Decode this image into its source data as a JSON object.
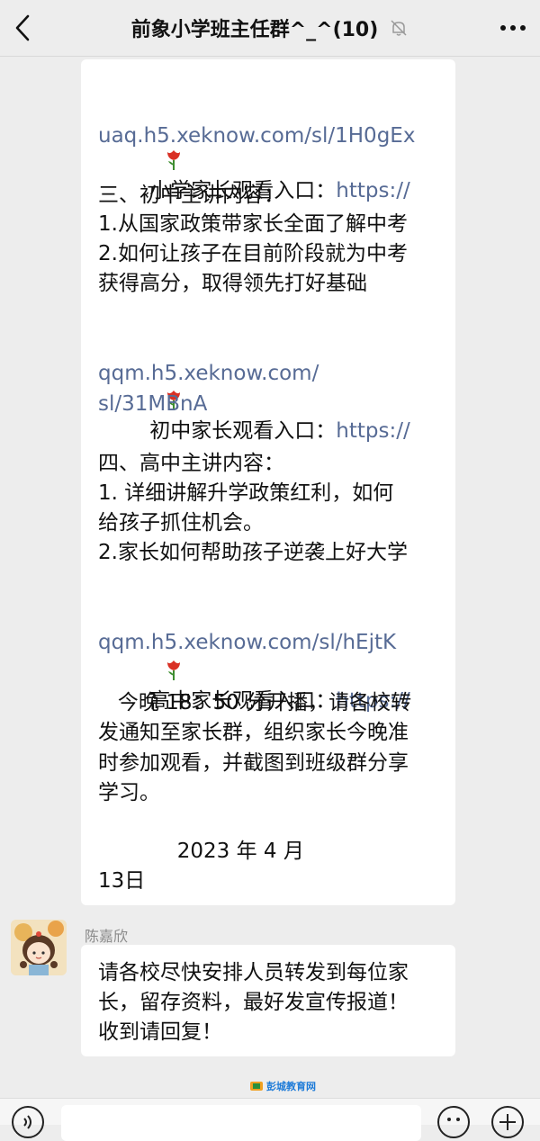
{
  "header": {
    "title": "前象小学班主任群^_^(10)",
    "back_icon": "chevron-left-icon",
    "mute_icon": "bell-muted-icon",
    "more_icon": "more-dots-icon"
  },
  "message_main": {
    "primary_entry_label": "小学家长观看入口：",
    "primary_entry_link_1": "https://",
    "primary_entry_link_2": "uaq.h5.xeknow.com/sl/1H0gEx",
    "junior_heading": "三、初中主讲内容：",
    "junior_point_1": "1.从国家政策带家长全面了解中考",
    "junior_point_2a": "2.如何让孩子在目前阶段就为中考",
    "junior_point_2b": "获得高分，取得领先打好基础",
    "junior_entry_label": "初中家长观看入口：",
    "junior_entry_link_1": "https://",
    "junior_entry_link_2": "qqm.h5.xeknow.com/",
    "junior_entry_link_3": "sl/31MBnA",
    "senior_heading": "四、高中主讲内容：",
    "senior_point_1a": "1. 详细讲解升学政策红利，如何",
    "senior_point_1b": "给孩子抓住机会。",
    "senior_point_2": "2.家长如何帮助孩子逆袭上好大学",
    "senior_entry_label": "高中家长观看入口：",
    "senior_entry_link_1": "https://",
    "senior_entry_link_2": "qqm.h5.xeknow.com/sl/hEjtK",
    "notice_1": "   今晚 18：50 分开播，请各校转",
    "notice_2": "发通知至家长群，组织家长今晚准",
    "notice_3": "时参加观看，并截图到班级群分享",
    "notice_4": "学习。",
    "date_1": "            2023 年 4 月",
    "date_2": "13日",
    "flower_icon": "tulip-icon"
  },
  "message_reply": {
    "sender": "陈嘉欣",
    "line_1": "请各校尽快安排人员转发到每位家",
    "line_2": "长，留存资料，最好发宣传报道！",
    "line_3": "收到请回复！",
    "avatar_icon": "girl-avatar-icon"
  },
  "watermark": {
    "text": "彭城教育网"
  },
  "bottombar": {
    "voice_icon": "voice-icon",
    "emoji_icon": "emoji-icon",
    "plus_icon": "plus-icon"
  },
  "colors": {
    "link": "#576b95",
    "background": "#ededed",
    "bubble": "#ffffff"
  }
}
